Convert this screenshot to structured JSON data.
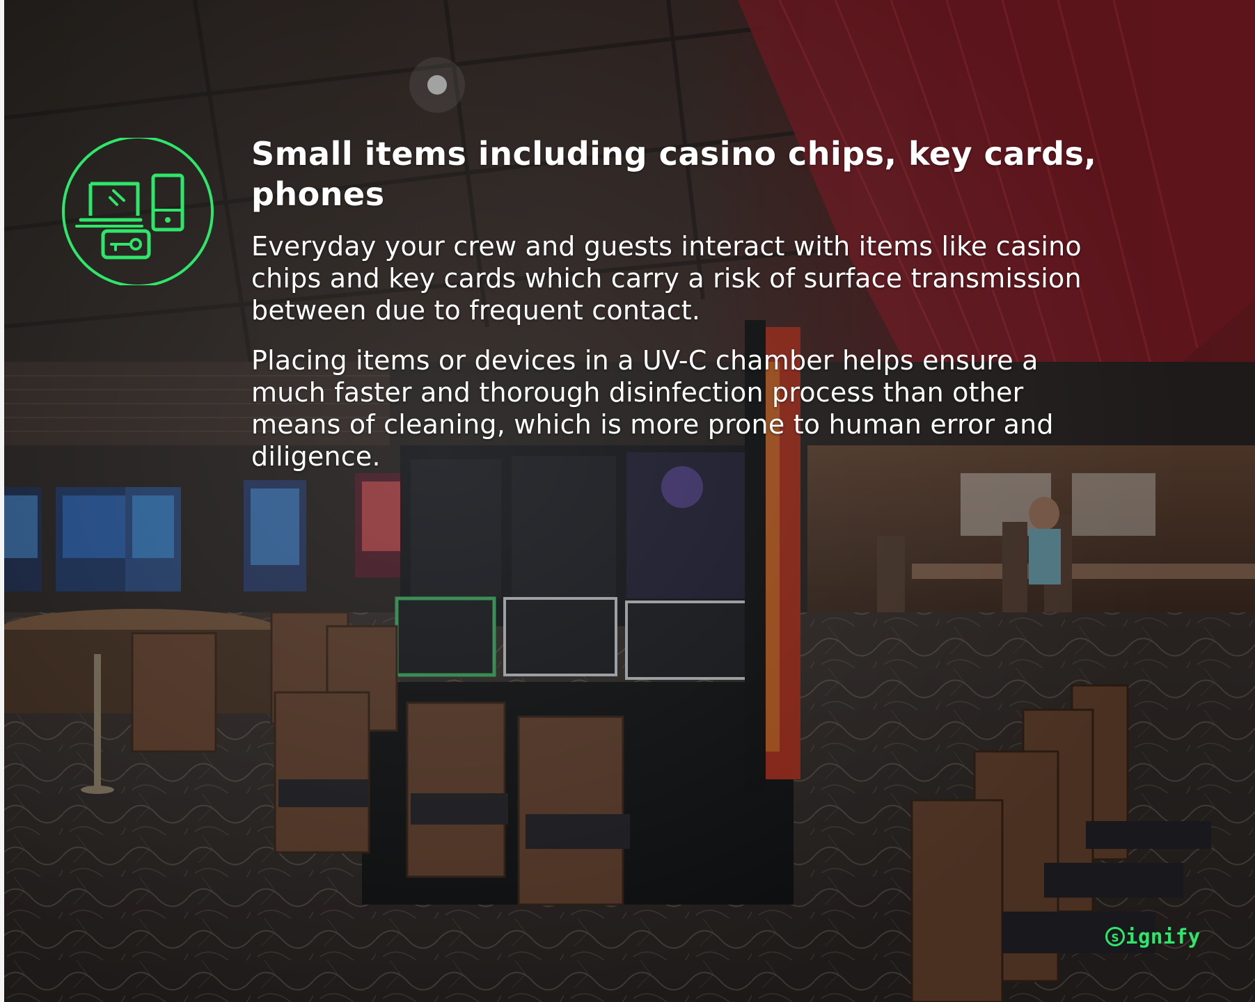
{
  "slide": {
    "headline": "Small items including casino chips, key cards, phones",
    "paragraphs": [
      "Everyday your crew and guests interact with items like casino chips and key cards which carry a risk of surface transmission between due to frequent contact.",
      "Placing items or devices in a UV-C chamber helps ensure a much faster and thorough disinfection process than other means of cleaning, which is more prone to human error and diligence."
    ]
  },
  "icon": {
    "name": "devices-keycard-icon",
    "color": "#2ee66a"
  },
  "background": {
    "description_icon": "casino-interior-photo",
    "overlay_color": "#000000"
  },
  "brand": {
    "logo_letter": "s",
    "logo_rest": "ignify",
    "color": "#2ee66a"
  }
}
